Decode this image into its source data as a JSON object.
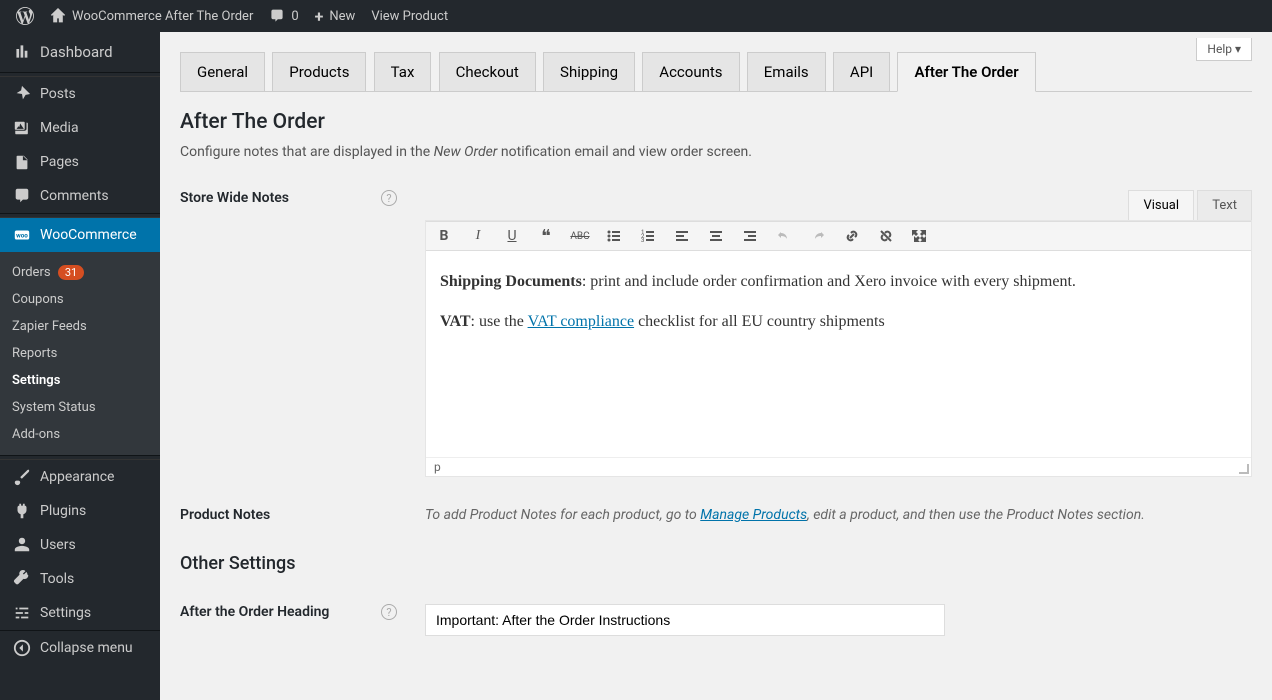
{
  "adminbar": {
    "site_name": "WooCommerce After The Order",
    "comments_count": "0",
    "new_label": "New",
    "view_label": "View Product"
  },
  "sidebar": {
    "dashboard": "Dashboard",
    "posts": "Posts",
    "media": "Media",
    "pages": "Pages",
    "comments": "Comments",
    "woocommerce": "WooCommerce",
    "wc_sub": {
      "orders": "Orders",
      "orders_count": "31",
      "coupons": "Coupons",
      "zapier": "Zapier Feeds",
      "reports": "Reports",
      "settings": "Settings",
      "system_status": "System Status",
      "addons": "Add-ons"
    },
    "appearance": "Appearance",
    "plugins": "Plugins",
    "users": "Users",
    "tools": "Tools",
    "settings": "Settings",
    "collapse": "Collapse menu"
  },
  "help": "Help ▾",
  "tabs": [
    "General",
    "Products",
    "Tax",
    "Checkout",
    "Shipping",
    "Accounts",
    "Emails",
    "API",
    "After The Order"
  ],
  "active_tab": "After The Order",
  "page": {
    "title": "After The Order",
    "desc_pre": "Configure notes that are displayed in the ",
    "desc_em": "New Order",
    "desc_post": " notification email and view order screen.",
    "store_notes_label": "Store Wide Notes",
    "product_notes_label": "Product Notes",
    "product_notes_desc_pre": "To add Product Notes for each product, go to ",
    "product_notes_link": "Manage Products",
    "product_notes_desc_post": ", edit a product, and then use the Product Notes section.",
    "other_settings_heading": "Other Settings",
    "heading_label": "After the Order Heading",
    "heading_value": "Important: After the Order Instructions"
  },
  "editor": {
    "visual_tab": "Visual",
    "text_tab": "Text",
    "content": {
      "p1_strong": "Shipping Documents",
      "p1_rest": ": print and include order confirmation and Xero invoice with every shipment.",
      "p2_strong": "VAT",
      "p2_pre": ": use the ",
      "p2_link": "VAT compliance",
      "p2_post": " checklist for all EU country shipments"
    },
    "status_path": "p"
  }
}
